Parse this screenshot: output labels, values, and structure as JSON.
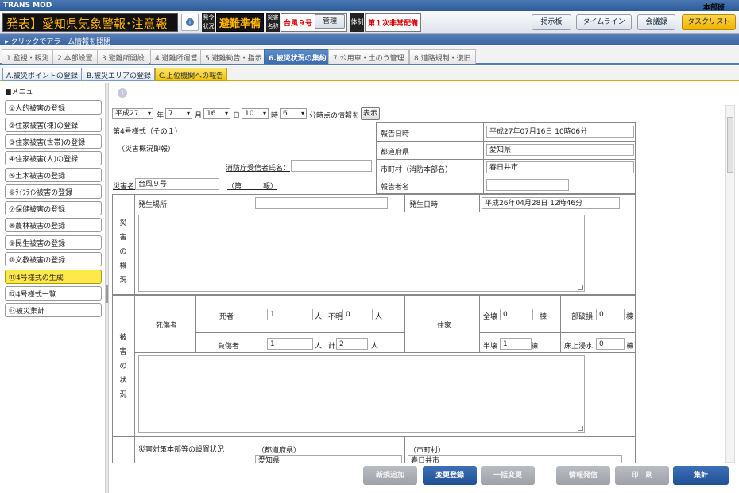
{
  "titlebar": {
    "app": "TRANS MOD",
    "user": "本部班"
  },
  "header": {
    "alert_title": "発表】愛知県気象警報･注意報",
    "status_label": "発令状況",
    "status_value": "避難準備",
    "disaster_label": "災害名称",
    "disaster_value": "台風９号",
    "kanri_button": "管理",
    "system_label": "体制",
    "system_value": "第１次非常配備",
    "buttons": [
      "掲示板",
      "タイムライン",
      "会議録",
      "タスクリスト"
    ]
  },
  "alarm_bar": "クリックでアラーム情報を開閉",
  "stage_tabs": [
    "1.監視・観測",
    "2.本部設置",
    "3.避難所開設",
    "4.避難所運営",
    "5.避難勧告・指示",
    "6.被災状況の集約",
    "7.公用車・土のう管理",
    "8.道路規制・復旧"
  ],
  "stage_active": 5,
  "sub_tabs": [
    "A.被災ポイントの登録",
    "B.被災エリアの登録",
    "C.上位機関への報告"
  ],
  "sub_active": 2,
  "sidebar": {
    "title": "■メニュー",
    "items": [
      "①人的被害の登録",
      "②住家被害(棟)の登録",
      "③住家被害(世帯)の登録",
      "④住家被害(人)の登録",
      "⑤土木被害の登録",
      "⑥ﾗｲﾌﾗｲﾝ被害の登録",
      "⑦保健被害の登録",
      "⑧農林被害の登録",
      "⑨民生被害の登録",
      "⑩文教被害の登録",
      "⑪4号様式の生成",
      "⑫4号様式一覧",
      "⑬被災集計"
    ],
    "active": 10
  },
  "form": {
    "time_selector": {
      "era": "平成27",
      "year_label": "年",
      "month": "7",
      "month_label": "月",
      "day": "16",
      "day_label": "日",
      "hour": "10",
      "hour_label": "時",
      "minute": "6",
      "minute_label": "分時点の情報を",
      "show_button": "表示"
    },
    "form_title": "第4号様式（その１）",
    "form_subtitle": "（災害概況即報）",
    "fire_dept_label": "消防庁受信者氏名：",
    "fire_dept_value": "",
    "disaster_name_label": "災害名：",
    "disaster_name_value": "台風９号",
    "report_no": "（第　　　報）",
    "report_datetime_label": "報告日時",
    "report_datetime_value": "平成27年07月16日 10時06分",
    "prefecture_label": "都道府県",
    "prefecture_value": "愛知県",
    "city_label": "市町村（消防本部名）",
    "city_value": "春日井市",
    "reporter_label": "報告者名",
    "reporter_value": "",
    "section1_label": "災害の概況",
    "location_label": "発生場所",
    "location_value": "",
    "occurred_label": "発生日時",
    "occurred_value": "平成26年04月28日 12時46分",
    "section2_label": "被害の状況",
    "casualty_label": "死傷者",
    "dead_label": "死者",
    "dead_value": "1",
    "person_unit": "人",
    "missing_label": "不明",
    "missing_value": "0",
    "injured_label": "負傷者",
    "injured_value": "1",
    "total_label": "計",
    "total_value": "2",
    "housing_label": "住家",
    "full_label": "全壊",
    "full_value": "0",
    "half_label": "半壊",
    "half_value": "1",
    "partial_label": "一部破損",
    "partial_value": "0",
    "floor_label": "床上浸水",
    "floor_value": "0",
    "building_unit": "棟",
    "hq_label": "災害対策本部等の設置状況",
    "hq_pref_label": "（都道府県）",
    "hq_pref_value": "愛知県",
    "hq_city_label": "（市町村）",
    "hq_city_value": "春日井市"
  },
  "bottom_buttons": [
    "新規追加",
    "変更登録",
    "一括変更",
    "情報発信",
    "印　刷",
    "集計"
  ]
}
